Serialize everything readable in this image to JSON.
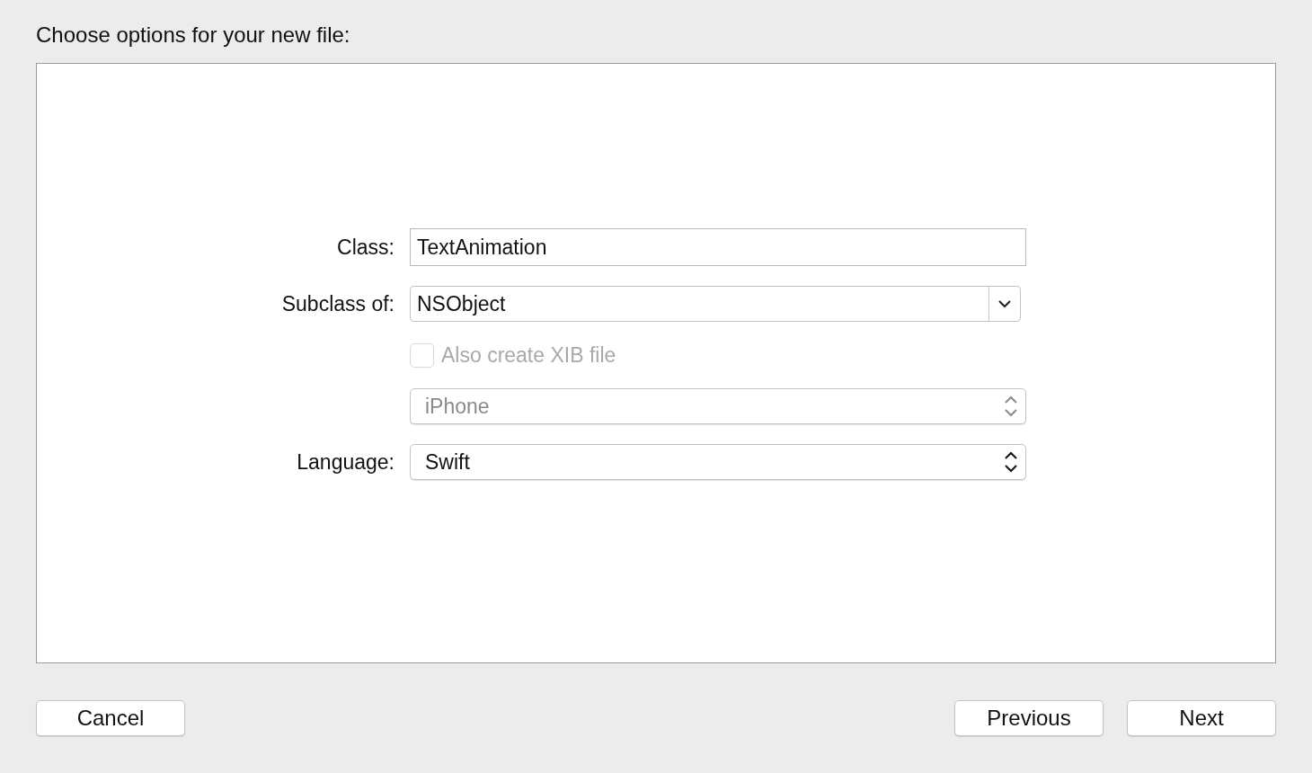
{
  "title": "Choose options for your new file:",
  "fields": [
    {
      "kind": "text",
      "label": "Class:",
      "value": "TextAnimation",
      "disabled": false
    },
    {
      "kind": "combo",
      "label": "Subclass of:",
      "value": "NSObject",
      "disabled": false
    },
    {
      "kind": "checkbox",
      "label": "Also create XIB file",
      "checked": false,
      "disabled": true
    },
    {
      "kind": "popup",
      "value": "iPhone",
      "disabled": true
    },
    {
      "kind": "popup",
      "label": "Language:",
      "value": "Swift",
      "disabled": false
    }
  ],
  "left_buttons": [
    "Cancel"
  ],
  "right_buttons": [
    "Previous",
    "Next"
  ]
}
